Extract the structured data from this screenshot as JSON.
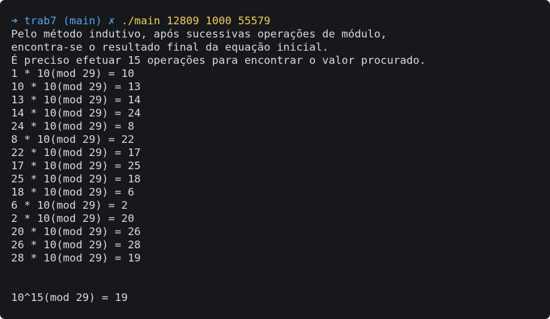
{
  "prompt": {
    "arrow": "➜",
    "directory": "trab7",
    "branch": "(main)",
    "dirty_marker": "✗",
    "command": "./main 12809 1000 55579"
  },
  "output": {
    "intro_lines": [
      "Pelo método indutivo, após sucessivas operações de módulo,",
      "encontra-se o resultado final da equação inicial.",
      "É preciso efetuar 15 operações para encontrar o valor procurado."
    ],
    "steps": [
      "1 * 10(mod 29) = 10",
      "10 * 10(mod 29) = 13",
      "13 * 10(mod 29) = 14",
      "14 * 10(mod 29) = 24",
      "24 * 10(mod 29) = 8",
      "8 * 10(mod 29) = 22",
      "22 * 10(mod 29) = 17",
      "17 * 10(mod 29) = 25",
      "25 * 10(mod 29) = 18",
      "18 * 10(mod 29) = 6",
      "6 * 10(mod 29) = 2",
      "2 * 10(mod 29) = 20",
      "20 * 10(mod 29) = 26",
      "26 * 10(mod 29) = 28",
      "28 * 10(mod 29) = 19"
    ],
    "result": "10^15(mod 29) = 19"
  },
  "colors": {
    "background": "#16181b",
    "text": "#d8dadd",
    "prompt": "#5aa2e8",
    "command": "#f1d150"
  }
}
